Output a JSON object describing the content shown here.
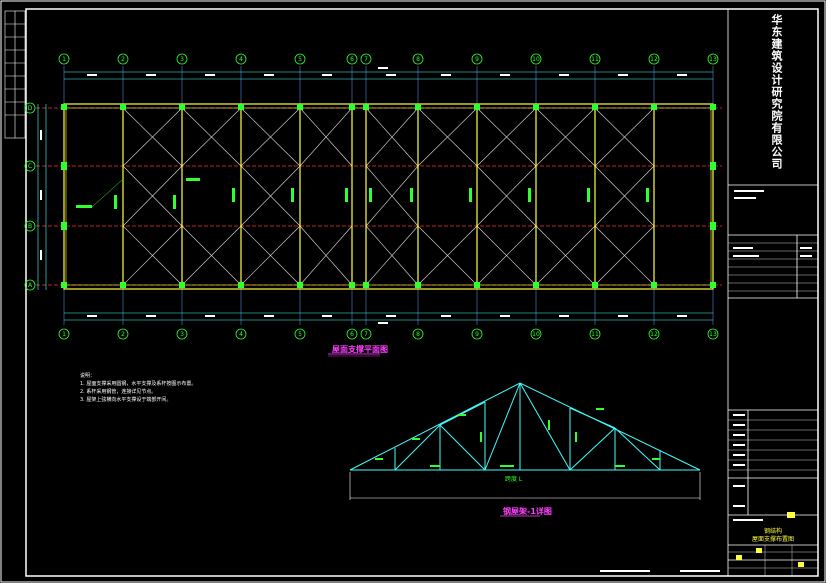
{
  "title_block": {
    "company": "华东建筑设计研究院有限公司",
    "drawing_title_line1": "钢结构",
    "drawing_title_line2": "屋面支撑布置图"
  },
  "plan": {
    "caption": "屋面支撑平面图",
    "axes_top": [
      "1",
      "2",
      "3",
      "4",
      "5",
      "6",
      "7",
      "8",
      "9",
      "10",
      "11",
      "12",
      "13"
    ],
    "rows": [
      "D",
      "C",
      "B",
      "A"
    ]
  },
  "truss": {
    "caption": "钢屋架-1详图",
    "span_label": "跨度 L"
  },
  "notes": {
    "heading": "说明：",
    "items": [
      "1. 屋面支撑采用圆钢，水平支撑及系杆按图示布置。",
      "2. 系杆采用钢管，连接详见节点。",
      "3. 屋架上弦横向水平支撑设于端部开间。"
    ]
  }
}
